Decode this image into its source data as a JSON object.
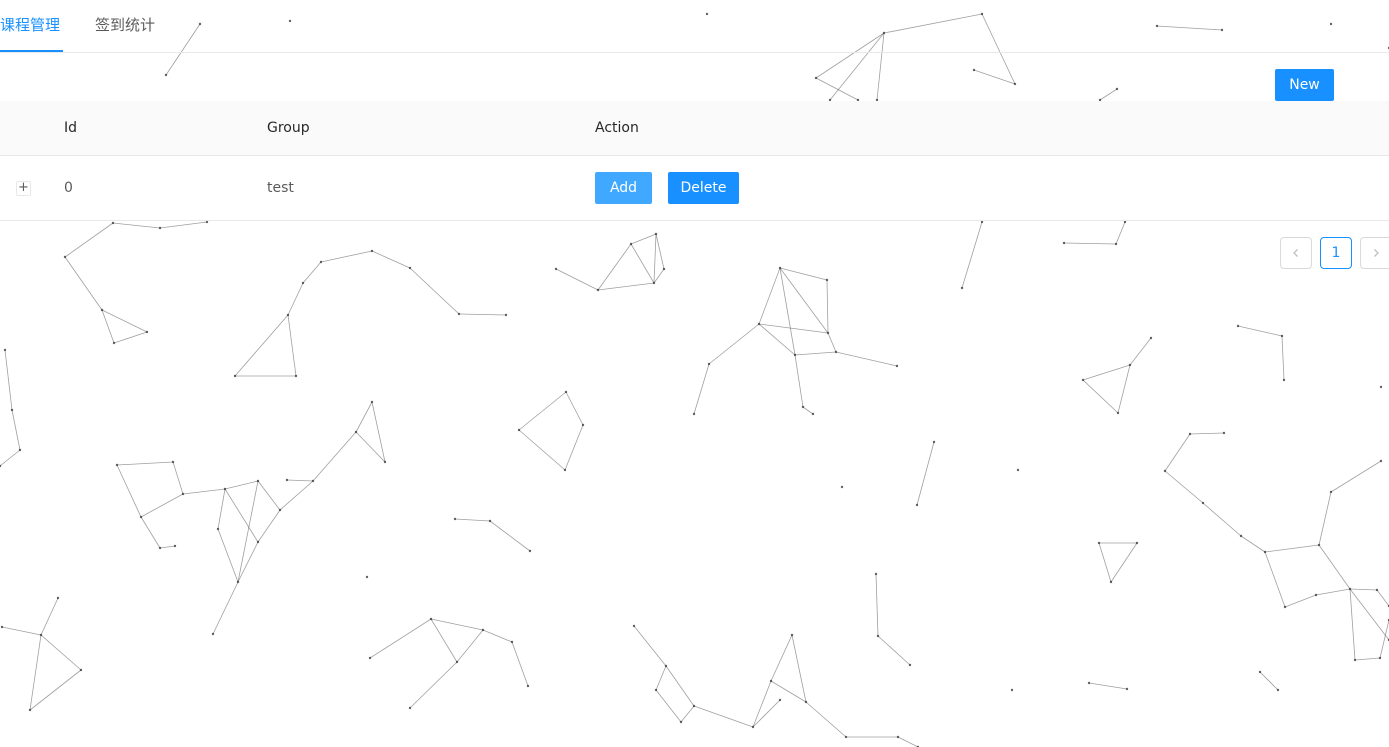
{
  "tabs": [
    {
      "label": "课程管理",
      "active": true
    },
    {
      "label": "签到统计",
      "active": false
    }
  ],
  "toolbar": {
    "new_label": "New"
  },
  "table": {
    "columns": [
      "Id",
      "Group",
      "Action"
    ],
    "rows": [
      {
        "id": "0",
        "group": "test",
        "add_label": "Add",
        "delete_label": "Delete"
      }
    ]
  },
  "pagination": {
    "prev_icon": "chevron-left-icon",
    "current_page": "1",
    "next_icon": "chevron-right-icon"
  },
  "colors": {
    "accent": "#1890ff",
    "accent_hover": "#40a9ff",
    "header_bg": "#fafafa",
    "border": "#e8e8e8"
  }
}
